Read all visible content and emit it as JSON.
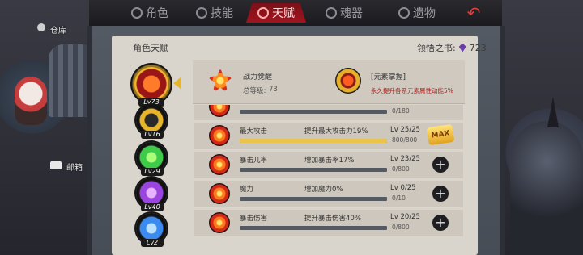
{
  "tabs": [
    {
      "label": "角色",
      "icon": "ghost-icon"
    },
    {
      "label": "技能",
      "icon": "swirl-icon"
    },
    {
      "label": "天赋",
      "icon": "wings-icon"
    },
    {
      "label": "魂器",
      "icon": "gem-icon"
    },
    {
      "label": "遗物",
      "icon": "skull-icon"
    }
  ],
  "active_tab": "天赋",
  "side": {
    "warehouse": "仓库",
    "mailbox": "邮箱"
  },
  "panel": {
    "title": "角色天赋",
    "book_label": "领悟之书:",
    "book_count": "723"
  },
  "categories": [
    {
      "level": "Lv73",
      "color": "#ff6a1a"
    },
    {
      "level": "Lv16",
      "color": "#e8b42a"
    },
    {
      "level": "Lv29",
      "color": "#3ecb4a"
    },
    {
      "level": "Lv40",
      "color": "#9b45e0"
    },
    {
      "level": "Lv2",
      "color": "#3a8af0"
    }
  ],
  "header": {
    "name": "战力觉醒",
    "total_level_label": "总等级:",
    "total_level": "73",
    "bonus_name": "[元素掌握]",
    "bonus_desc": "永久提升各系元素属性动能5%"
  },
  "rows": [
    {
      "name": "",
      "desc": "",
      "level": "",
      "exp": "0/180",
      "progress": 0,
      "maxed": false
    },
    {
      "name": "最大攻击",
      "desc": "提升最大攻击力19%",
      "level": "Lv 25/25",
      "exp": "800/800",
      "progress": 1,
      "maxed": true
    },
    {
      "name": "暴击几率",
      "desc": "增加暴击率17%",
      "level": "Lv 23/25",
      "exp": "0/800",
      "progress": 0,
      "maxed": false
    },
    {
      "name": "魔力",
      "desc": "增加魔力0%",
      "level": "Lv 0/25",
      "exp": "0/10",
      "progress": 0,
      "maxed": false
    },
    {
      "name": "暴击伤害",
      "desc": "提升暴击伤害40%",
      "level": "Lv 20/25",
      "exp": "0/800",
      "progress": 0,
      "maxed": false
    }
  ],
  "max_badge": "MAX"
}
